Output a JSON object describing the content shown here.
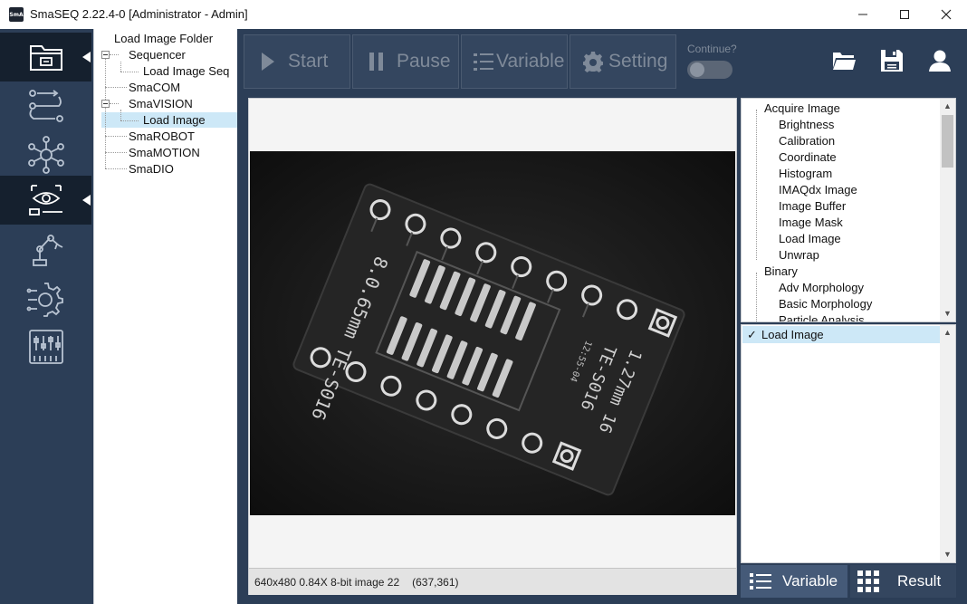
{
  "window": {
    "app_icon_text": "SmA",
    "title": "SmaSEQ 2.22.4-0 [Administrator - Admin]"
  },
  "nav": {
    "items": [
      {
        "icon": "folder-icon",
        "active": true
      },
      {
        "icon": "sequence-flow-icon",
        "active": false
      },
      {
        "icon": "network-hub-icon",
        "active": false
      },
      {
        "icon": "vision-eye-icon",
        "active": true
      },
      {
        "icon": "robot-arm-icon",
        "active": false
      },
      {
        "icon": "gear-circuit-icon",
        "active": false
      },
      {
        "icon": "io-panel-icon",
        "active": false
      }
    ]
  },
  "tree": {
    "root": "Load Image Folder",
    "sequencer": "Sequencer",
    "load_image_seq": "Load Image Seq",
    "smacom": "SmaCOM",
    "smavision": "SmaVISION",
    "load_image": "Load Image",
    "smarobot": "SmaROBOT",
    "smamotion": "SmaMOTION",
    "smadio": "SmaDIO"
  },
  "toolbar": {
    "start": "Start",
    "pause": "Pause",
    "variable": "Variable",
    "setting": "Setting",
    "continue_label": "Continue?"
  },
  "viewer": {
    "status": "640x480 0.84X 8-bit image 22",
    "coords": "(637,361)",
    "pcb": {
      "left_text": "8.0.65mm TE-S016",
      "right_text": "1.27mm 16",
      "right_text_2": "TE-S016",
      "small_text": "12:55-04"
    }
  },
  "functions": {
    "groups": [
      {
        "name": "Acquire Image",
        "items": [
          "Brightness",
          "Calibration",
          "Coordinate",
          "Histogram",
          "IMAQdx Image",
          "Image Buffer",
          "Image Mask",
          "Load Image",
          "Unwrap"
        ]
      },
      {
        "name": "Binary",
        "items": [
          "Adv Morphology",
          "Basic Morphology",
          "Particle Analysis"
        ]
      }
    ]
  },
  "steps": {
    "items": [
      {
        "check": "✓",
        "label": "Load Image"
      }
    ]
  },
  "tabs": {
    "variable": "Variable",
    "result": "Result"
  },
  "colors": {
    "nav_bg": "#2c3e57",
    "nav_active": "#15202e",
    "selection": "#cde8f7"
  }
}
